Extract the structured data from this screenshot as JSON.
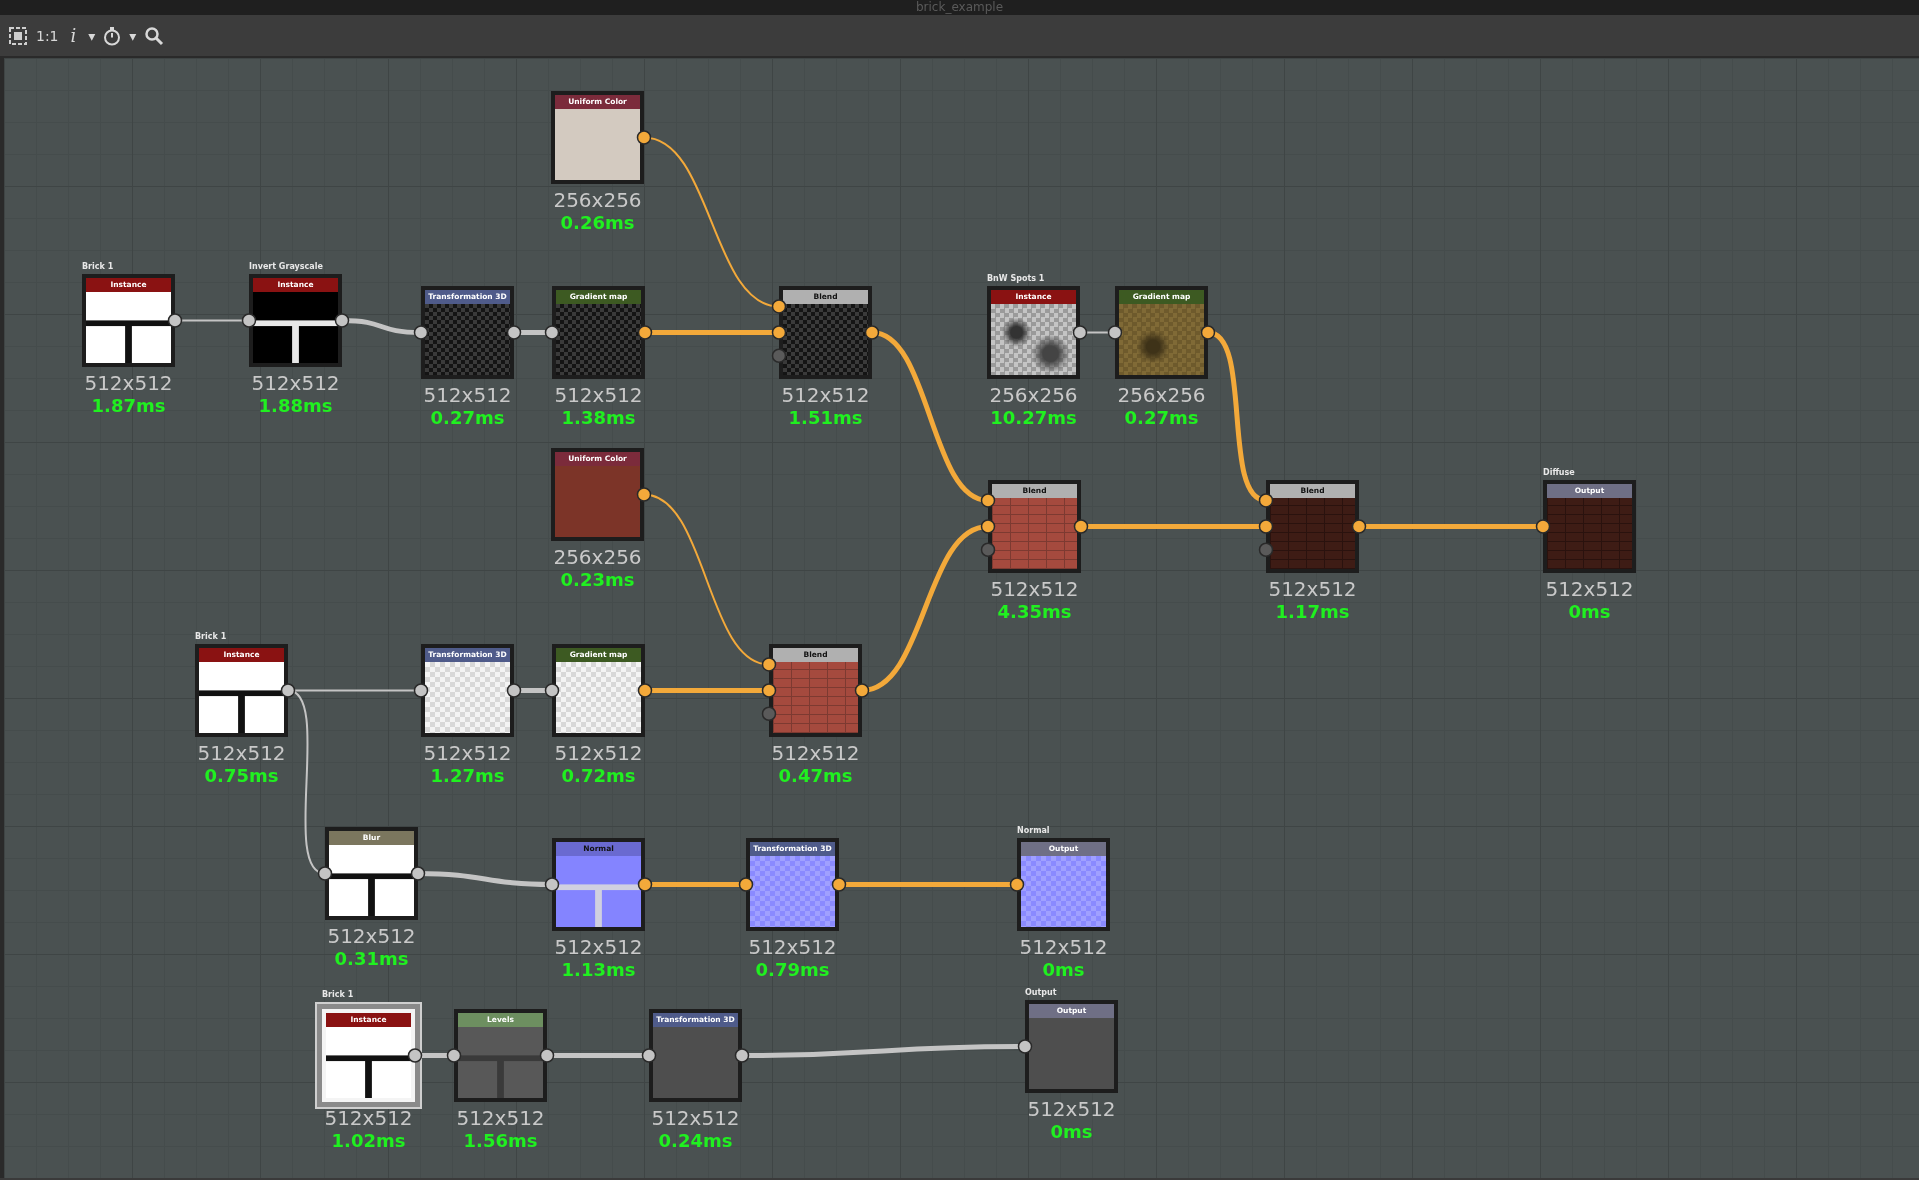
{
  "window": {
    "title": "brick_example"
  },
  "toolbar": {
    "zoom_label": "1:1",
    "info_label": "i",
    "carets": [
      "▾",
      "▾"
    ]
  },
  "nodes": [
    {
      "kind": "uniform",
      "title": "Uniform Color",
      "resolution": "256x256",
      "time": "0.26ms",
      "selected": false
    },
    {
      "kind": "instance",
      "title": "Instance",
      "label": "Brick 1",
      "resolution": "512x512",
      "time": "1.87ms",
      "selected": false
    },
    {
      "kind": "instance",
      "title": "Instance",
      "label": "Invert Grayscale",
      "resolution": "512x512",
      "time": "1.88ms",
      "selected": false
    },
    {
      "kind": "transformation",
      "title": "Transformation 3D",
      "resolution": "512x512",
      "time": "0.27ms",
      "selected": false
    },
    {
      "kind": "gradient",
      "title": "Gradient map",
      "resolution": "512x512",
      "time": "1.38ms",
      "selected": false
    },
    {
      "kind": "blend",
      "title": "Blend",
      "resolution": "512x512",
      "time": "1.51ms",
      "selected": false
    },
    {
      "kind": "instance",
      "title": "Instance",
      "label": "BnW Spots 1",
      "resolution": "256x256",
      "time": "10.27ms",
      "selected": false
    },
    {
      "kind": "gradient",
      "title": "Gradient map",
      "resolution": "256x256",
      "time": "0.27ms",
      "selected": false
    },
    {
      "kind": "uniform",
      "title": "Uniform Color",
      "resolution": "256x256",
      "time": "0.23ms",
      "selected": false
    },
    {
      "kind": "blend",
      "title": "Blend",
      "resolution": "512x512",
      "time": "4.35ms",
      "selected": false
    },
    {
      "kind": "blend",
      "title": "Blend",
      "resolution": "512x512",
      "time": "1.17ms",
      "selected": false
    },
    {
      "kind": "output",
      "title": "Output",
      "label": "Diffuse",
      "resolution": "512x512",
      "time": "0ms",
      "selected": false
    },
    {
      "kind": "instance",
      "title": "Instance",
      "label": "Brick 1",
      "resolution": "512x512",
      "time": "0.75ms",
      "selected": false
    },
    {
      "kind": "transformation",
      "title": "Transformation 3D",
      "resolution": "512x512",
      "time": "1.27ms",
      "selected": false
    },
    {
      "kind": "gradient",
      "title": "Gradient map",
      "resolution": "512x512",
      "time": "0.72ms",
      "selected": false
    },
    {
      "kind": "blend",
      "title": "Blend",
      "resolution": "512x512",
      "time": "0.47ms",
      "selected": false
    },
    {
      "kind": "blur",
      "title": "Blur",
      "resolution": "512x512",
      "time": "0.31ms",
      "selected": false
    },
    {
      "kind": "normal",
      "title": "Normal",
      "resolution": "512x512",
      "time": "1.13ms",
      "selected": false
    },
    {
      "kind": "transformation",
      "title": "Transformation 3D",
      "resolution": "512x512",
      "time": "0.79ms",
      "selected": false
    },
    {
      "kind": "output",
      "title": "Output",
      "label": "Normal",
      "resolution": "512x512",
      "time": "0ms",
      "selected": false
    },
    {
      "kind": "instance",
      "title": "Instance",
      "label": "Brick 1",
      "resolution": "512x512",
      "time": "1.02ms",
      "selected": true
    },
    {
      "kind": "levels",
      "title": "Levels",
      "resolution": "512x512",
      "time": "1.56ms",
      "selected": false
    },
    {
      "kind": "transformation",
      "title": "Transformation 3D",
      "resolution": "512x512",
      "time": "0.24ms",
      "selected": false
    },
    {
      "kind": "output",
      "title": "Output",
      "label": "Output",
      "resolution": "512x512",
      "time": "0ms",
      "selected": false
    }
  ]
}
